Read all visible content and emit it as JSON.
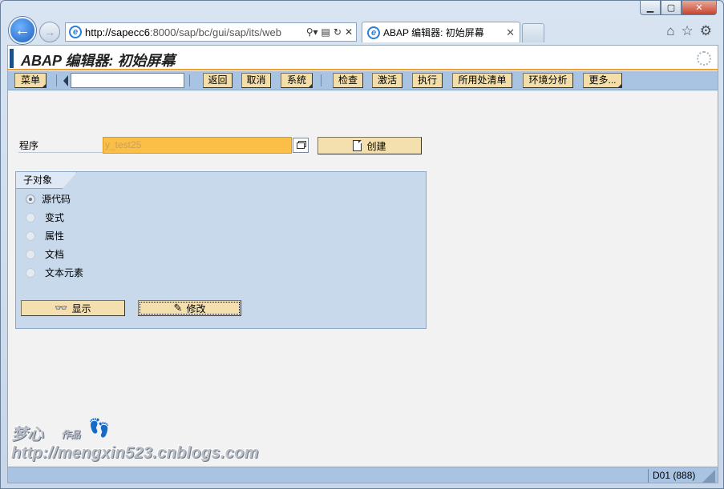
{
  "browser": {
    "address_host": "http://sapecc6",
    "address_rest": ":8000/sap/bc/gui/sap/its/web",
    "tab_title": "ABAP 编辑器: 初始屏幕"
  },
  "sap": {
    "title": "ABAP 编辑器: 初始屏幕",
    "toolbar": {
      "menu": "菜单",
      "back": "返回",
      "cancel": "取消",
      "system": "系统",
      "check": "检查",
      "activate": "激活",
      "execute": "执行",
      "where_used": "所用处清单",
      "environment": "环境分析",
      "more": "更多..."
    },
    "program_label": "程序",
    "program_value": "y_test25",
    "create_label": "创建",
    "subobjects": {
      "title": "子对象",
      "options": [
        "源代码",
        "变式",
        "属性",
        "文档",
        "文本元素"
      ],
      "selected": "源代码"
    },
    "display_label": "显示",
    "change_label": "修改",
    "status_system": "D01 (888)"
  },
  "watermark": {
    "name": "梦心",
    "sub": "作品",
    "url": "http://mengxin523.cnblogs.com"
  },
  "colors": {
    "accent": "#f0a030",
    "toolbar_bg": "#a9c3e2",
    "button_bg": "#f3dea9",
    "input_highlight": "#fbbe46"
  }
}
